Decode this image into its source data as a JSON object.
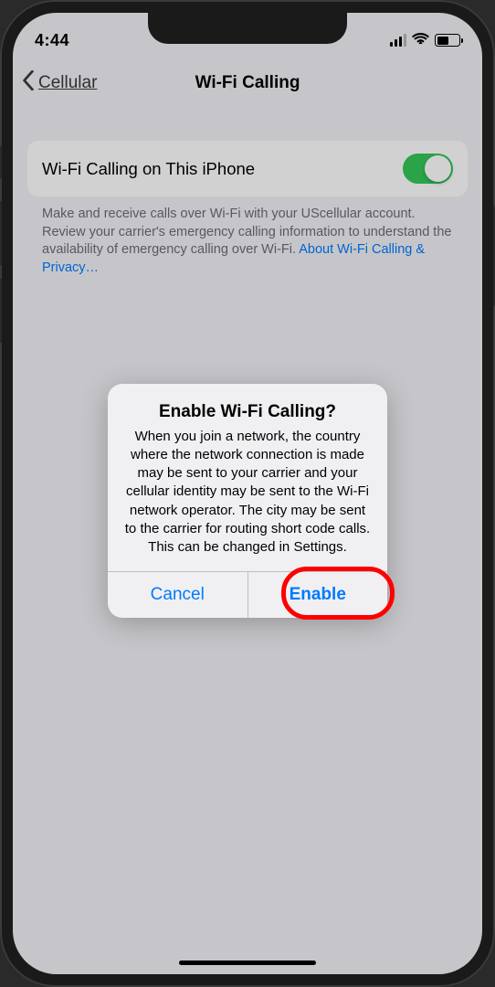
{
  "status": {
    "time": "4:44"
  },
  "nav": {
    "back_label": "Cellular",
    "title": "Wi-Fi Calling"
  },
  "setting": {
    "label": "Wi-Fi Calling on This iPhone",
    "toggle_on": true
  },
  "footer": {
    "text": "Make and receive calls over Wi-Fi with your UScellular account. Review your carrier's emergency calling information to understand the availability of emergency calling over Wi-Fi. ",
    "link_text": "About Wi-Fi Calling & Privacy…"
  },
  "alert": {
    "title": "Enable Wi-Fi Calling?",
    "message": "When you join a network, the country where the network connection is made may be sent to your carrier and your cellular identity may be sent to the Wi-Fi network operator. The city may be sent to the carrier for routing short code calls. This can be changed in Settings.",
    "cancel_label": "Cancel",
    "confirm_label": "Enable"
  }
}
